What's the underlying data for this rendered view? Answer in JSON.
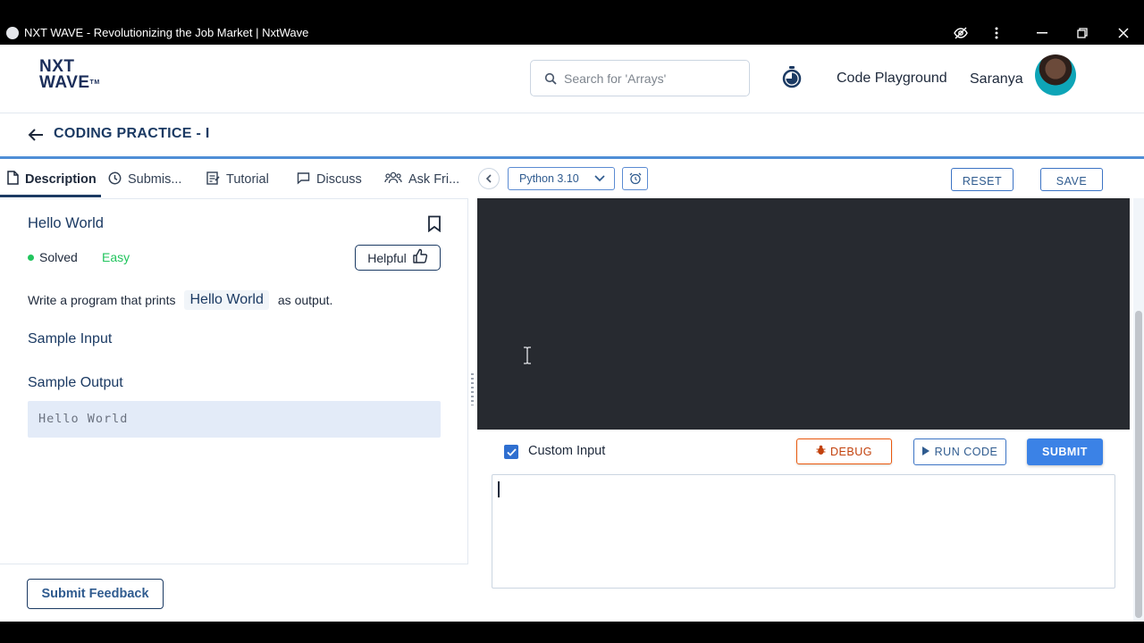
{
  "window": {
    "title": "NXT WAVE - Revolutionizing the Job Market | NxtWave"
  },
  "header": {
    "logo_line1": "NXT",
    "logo_line2": "WAVE",
    "logo_tm": "TM",
    "search_placeholder": "Search for 'Arrays'",
    "playground_label": "Code Playground",
    "user_name": "Saranya"
  },
  "breadcrumb": {
    "title": "CODING PRACTICE - I"
  },
  "tabs": [
    {
      "label": "Description",
      "icon": "document-icon",
      "active": true
    },
    {
      "label": "Submis...",
      "icon": "clock-icon",
      "active": false
    },
    {
      "label": "Tutorial",
      "icon": "tutorial-icon",
      "active": false
    },
    {
      "label": "Discuss",
      "icon": "chat-icon",
      "active": false
    },
    {
      "label": "Ask Fri...",
      "icon": "people-icon",
      "active": false
    }
  ],
  "problem": {
    "title": "Hello World",
    "status": "Solved",
    "difficulty": "Easy",
    "helpful_label": "Helpful",
    "desc_before": "Write a program that prints",
    "desc_code": "Hello World",
    "desc_after": "as output.",
    "sample_input_heading": "Sample Input",
    "sample_output_heading": "Sample Output",
    "sample_output": "Hello World"
  },
  "feedback": {
    "label": "Submit Feedback"
  },
  "editor": {
    "language": "Python 3.10",
    "reset_label": "RESET",
    "save_label": "SAVE",
    "custom_input_label": "Custom Input",
    "custom_input_checked": true,
    "debug_label": "DEBUG",
    "run_label": "RUN CODE",
    "submit_label": "SUBMIT"
  },
  "colors": {
    "primary": "#1b3a63",
    "accent": "#3b82e6",
    "success": "#22c55e",
    "debug": "#ea580c",
    "editor_bg": "#272a30"
  }
}
